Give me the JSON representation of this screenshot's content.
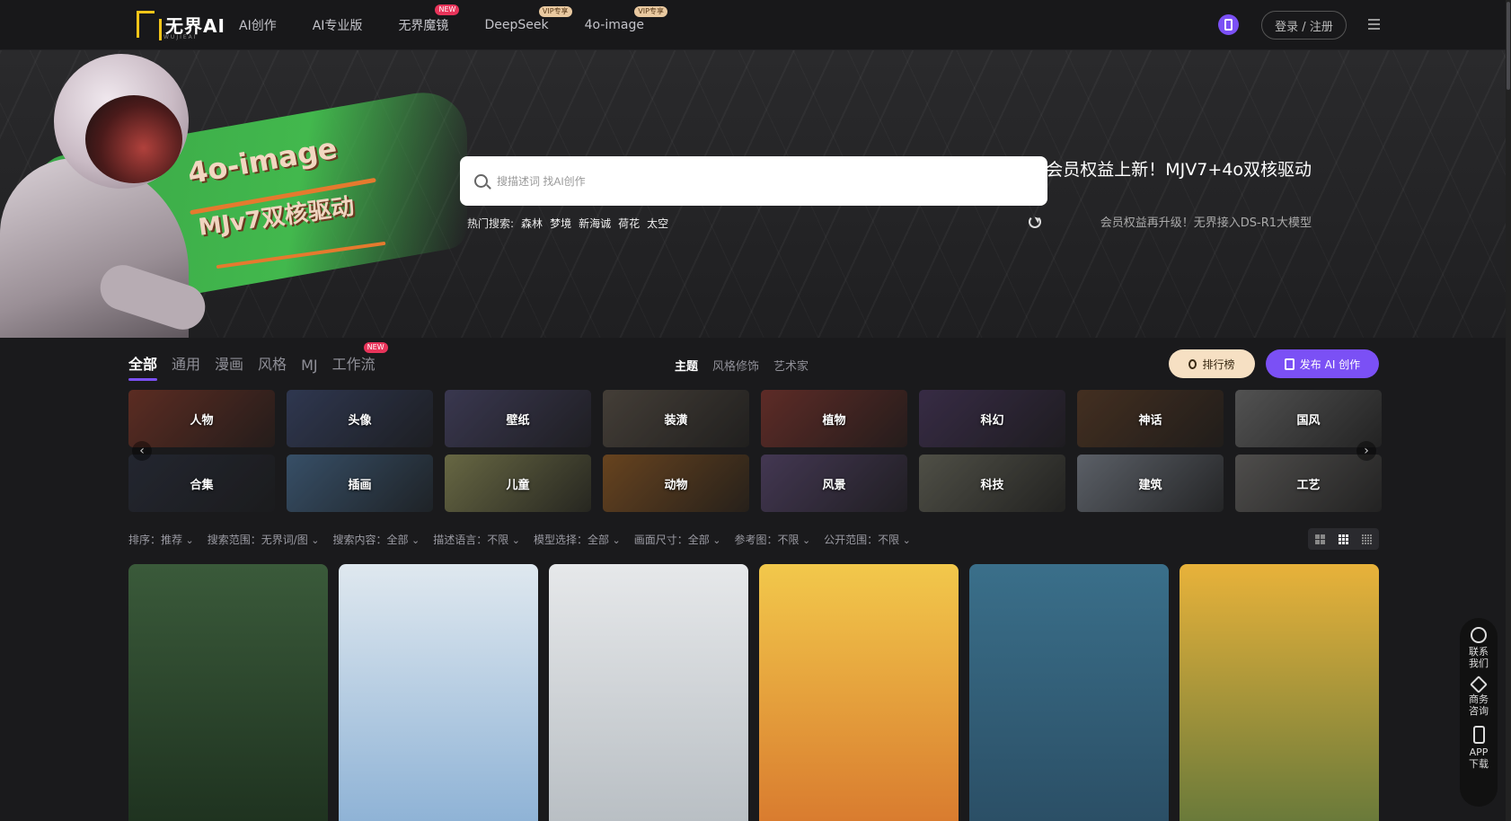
{
  "nav": {
    "logo_text": "无界AI",
    "logo_sub": "WUJIEAI",
    "links": [
      {
        "label": "AI创作",
        "badge": ""
      },
      {
        "label": "AI专业版",
        "badge": ""
      },
      {
        "label": "无界魔镜",
        "badge": "NEW"
      },
      {
        "label": "DeepSeek",
        "badge": "VIP专享"
      },
      {
        "label": "4o-image",
        "badge": "VIP专享"
      }
    ],
    "login_label": "登录 / 注册"
  },
  "hero": {
    "banner_title": "4o-image",
    "banner_subtitle": "MJv7双核驱动",
    "search_placeholder": "搜描述词 找AI创作",
    "hot_label": "热门搜索:",
    "hot_terms": [
      "森林",
      "梦境",
      "新海诚",
      "荷花",
      "太空"
    ],
    "promo_title": "会员权益上新！MJV7+4o双核驱动",
    "promo_sub": "会员权益再升级！无界接入DS-R1大模型"
  },
  "tabs": [
    {
      "label": "全部",
      "active": true,
      "badge": ""
    },
    {
      "label": "通用",
      "active": false,
      "badge": ""
    },
    {
      "label": "漫画",
      "active": false,
      "badge": ""
    },
    {
      "label": "风格",
      "active": false,
      "badge": ""
    },
    {
      "label": "MJ",
      "active": false,
      "badge": ""
    },
    {
      "label": "工作流",
      "active": false,
      "badge": "NEW"
    }
  ],
  "subtabs": [
    {
      "label": "主题",
      "active": true
    },
    {
      "label": "风格修饰",
      "active": false
    },
    {
      "label": "艺术家",
      "active": false
    }
  ],
  "actions": {
    "rank_label": "排行榜",
    "publish_label": "发布 AI 创作"
  },
  "categories": [
    {
      "label": "人物",
      "color": "#7a3b2e"
    },
    {
      "label": "头像",
      "color": "#3f4a6b"
    },
    {
      "label": "壁纸",
      "color": "#4d4a6a"
    },
    {
      "label": "装潢",
      "color": "#5b534a"
    },
    {
      "label": "植物",
      "color": "#7d3a34"
    },
    {
      "label": "科幻",
      "color": "#4a3a5c"
    },
    {
      "label": "神话",
      "color": "#5a3f2c"
    },
    {
      "label": "国风",
      "color": "#6e6e6e"
    },
    {
      "label": "合集",
      "color": "#2f3340"
    },
    {
      "label": "插画",
      "color": "#4a6a8a"
    },
    {
      "label": "儿童",
      "color": "#8a8a5a"
    },
    {
      "label": "动物",
      "color": "#8a5a2a"
    },
    {
      "label": "风景",
      "color": "#5a4a6e"
    },
    {
      "label": "科技",
      "color": "#6a6a5e"
    },
    {
      "label": "建筑",
      "color": "#7a808a"
    },
    {
      "label": "工艺",
      "color": "#6a6866"
    }
  ],
  "sort": [
    "排序：推荐",
    "搜索范围：无界词/图",
    "搜索内容：全部",
    "描述语言：不限",
    "模型选择：全部",
    "画面尺寸：全部",
    "参考图：不限",
    "公开范围：不限"
  ],
  "gallery": [
    {
      "color_top": "#3a5a3a",
      "color_bottom": "#1f3320"
    },
    {
      "color_top": "#dfe8ef",
      "color_bottom": "#8fb3d6"
    },
    {
      "color_top": "#e6e8ea",
      "color_bottom": "#b9bfc4"
    },
    {
      "color_top": "#f2c84b",
      "color_bottom": "#d97c2f"
    },
    {
      "color_top": "#3a6f8a",
      "color_bottom": "#2b4f66"
    },
    {
      "color_top": "#e8b23a",
      "color_bottom": "#6a7a3a"
    }
  ],
  "side": [
    {
      "label": "联系我们",
      "icon": "headset-icon"
    },
    {
      "label": "商务咨询",
      "icon": "handshake-icon"
    },
    {
      "label": "APP下载",
      "icon": "phone-icon"
    }
  ]
}
